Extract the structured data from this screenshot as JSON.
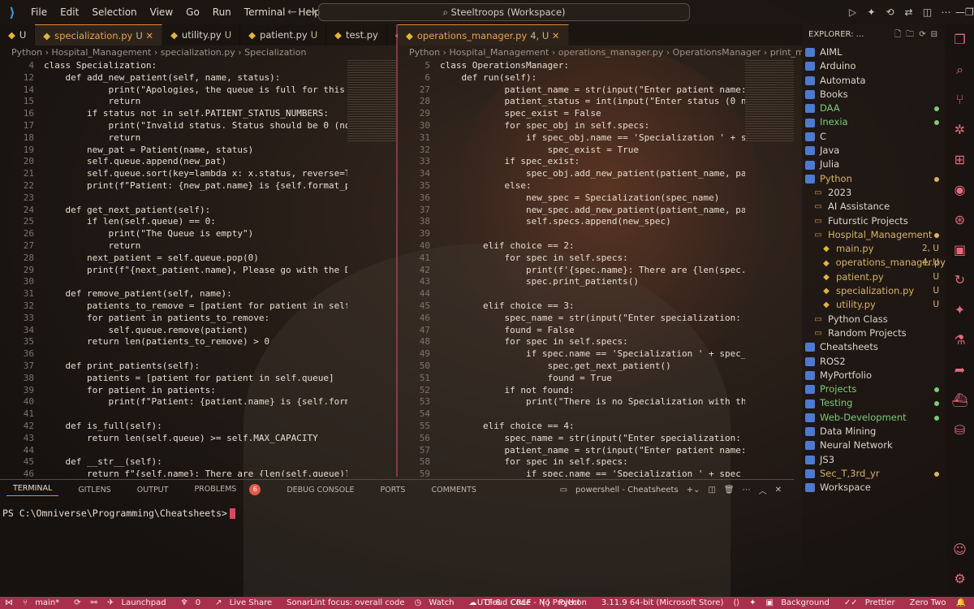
{
  "window": {
    "title": "Steeltroops (Workspace)",
    "menu": [
      "File",
      "Edit",
      "Selection",
      "View",
      "Go",
      "Run",
      "Terminal",
      "Help"
    ]
  },
  "tabs_left": [
    {
      "name": "U",
      "mod": ""
    },
    {
      "name": "specialization.py",
      "mod": "U",
      "active": true
    },
    {
      "name": "utility.py",
      "mod": "U"
    },
    {
      "name": "patient.py",
      "mod": "U"
    },
    {
      "name": "test.py",
      "mod": ""
    },
    {
      "name": "3",
      "mod": ""
    }
  ],
  "tabs_right": [
    {
      "name": "operations_manager.py",
      "mod": "4, U",
      "active": true
    }
  ],
  "breadcrumb_left": "Python › Hospital_Management › specialization.py › Specialization",
  "breadcrumb_right": "Python › Hospital_Management › operations_manager.py › OperationsManager › print_m",
  "editor_left": [
    {
      "n": "4",
      "c": "class Specialization:"
    },
    {
      "n": "12",
      "c": "    def add_new_patient(self, name, status):"
    },
    {
      "n": "14",
      "c": "            print(\"Apologies, the queue is full for this spec"
    },
    {
      "n": "15",
      "c": "            return"
    },
    {
      "n": "16",
      "c": "        if status not in self.PATIENT_STATUS_NUMBERS:"
    },
    {
      "n": "17",
      "c": "            print(\"Invalid status. Status should be 0 (normal"
    },
    {
      "n": "18",
      "c": "            return"
    },
    {
      "n": "19",
      "c": "        new_pat = Patient(name, status)"
    },
    {
      "n": "20",
      "c": "        self.queue.append(new_pat)"
    },
    {
      "n": "21",
      "c": "        self.queue.sort(key=lambda x: x.status, reverse=True)"
    },
    {
      "n": "22",
      "c": "        print(f\"Patient: {new_pat.name} is {self.format_patien"
    },
    {
      "n": "23",
      "c": ""
    },
    {
      "n": "24",
      "c": "    def get_next_patient(self):"
    },
    {
      "n": "25",
      "c": "        if len(self.queue) == 0:"
    },
    {
      "n": "26",
      "c": "            print(\"The Queue is empty\")"
    },
    {
      "n": "27",
      "c": "            return"
    },
    {
      "n": "28",
      "c": "        next_patient = self.queue.pop(0)"
    },
    {
      "n": "29",
      "c": "        print(f\"{next_patient.name}, Please go with the Dr\")"
    },
    {
      "n": "30",
      "c": ""
    },
    {
      "n": "31",
      "c": "    def remove_patient(self, name):"
    },
    {
      "n": "32",
      "c": "        patients_to_remove = [patient for patient in self.queu"
    },
    {
      "n": "33",
      "c": "        for patient in patients_to_remove:"
    },
    {
      "n": "34",
      "c": "            self.queue.remove(patient)"
    },
    {
      "n": "35",
      "c": "        return len(patients_to_remove) > 0"
    },
    {
      "n": "36",
      "c": ""
    },
    {
      "n": "37",
      "c": "    def print_patients(self):"
    },
    {
      "n": "38",
      "c": "        patients = [patient for patient in self.queue]"
    },
    {
      "n": "39",
      "c": "        for patient in patients:"
    },
    {
      "n": "40",
      "c": "            print(f\"Patient: {patient.name} is {self.format_pa"
    },
    {
      "n": "41",
      "c": ""
    },
    {
      "n": "42",
      "c": "    def is_full(self):"
    },
    {
      "n": "43",
      "c": "        return len(self.queue) >= self.MAX_CAPACITY"
    },
    {
      "n": "44",
      "c": ""
    },
    {
      "n": "45",
      "c": "    def __str__(self):"
    },
    {
      "n": "46",
      "c": "        return f\"{self.name}: There are {len(self.queue)} pat"
    }
  ],
  "editor_right": [
    {
      "n": "5",
      "c": "class OperationsManager:"
    },
    {
      "n": "6",
      "c": "    def run(self):"
    },
    {
      "n": "27",
      "c": "            patient_name = str(input(\"Enter patient name: "
    },
    {
      "n": "28",
      "c": "            patient_status = int(input(\"Enter status (0 no"
    },
    {
      "n": "29",
      "c": "            spec_exist = False"
    },
    {
      "n": "30",
      "c": "            for spec_obj in self.specs:"
    },
    {
      "n": "31",
      "c": "                if spec_obj.name == 'Specialization ' + sp"
    },
    {
      "n": "32",
      "c": "                    spec_exist = True"
    },
    {
      "n": "33",
      "c": "            if spec_exist:"
    },
    {
      "n": "34",
      "c": "                spec_obj.add_new_patient(patient_name, pat"
    },
    {
      "n": "35",
      "c": "            else:"
    },
    {
      "n": "36",
      "c": "                new_spec = Specialization(spec_name)"
    },
    {
      "n": "37",
      "c": "                new_spec.add_new_patient(patient_name, pat"
    },
    {
      "n": "38",
      "c": "                self.specs.append(new_spec)"
    },
    {
      "n": "39",
      "c": ""
    },
    {
      "n": "40",
      "c": "        elif choice == 2:"
    },
    {
      "n": "41",
      "c": "            for spec in self.specs:"
    },
    {
      "n": "42",
      "c": "                print(f'{spec.name}: There are {len(spec.q"
    },
    {
      "n": "43",
      "c": "                spec.print_patients()"
    },
    {
      "n": "44",
      "c": ""
    },
    {
      "n": "45",
      "c": "        elif choice == 3:"
    },
    {
      "n": "46",
      "c": "            spec_name = str(input(\"Enter specialization: '"
    },
    {
      "n": "47",
      "c": "            found = False"
    },
    {
      "n": "48",
      "c": "            for spec in self.specs:"
    },
    {
      "n": "49",
      "c": "                if spec.name == 'Specialization ' + spec_n"
    },
    {
      "n": "50",
      "c": "                    spec.get_next_patient()"
    },
    {
      "n": "51",
      "c": "                    found = True"
    },
    {
      "n": "52",
      "c": "            if not found:"
    },
    {
      "n": "53",
      "c": "                print(\"There is no Specialization with th"
    },
    {
      "n": "54",
      "c": ""
    },
    {
      "n": "55",
      "c": "        elif choice == 4:"
    },
    {
      "n": "56",
      "c": "            spec_name = str(input(\"Enter specialization: '"
    },
    {
      "n": "57",
      "c": "            patient_name = str(input(\"Enter patient name: "
    },
    {
      "n": "58",
      "c": "            for spec in self.specs:"
    },
    {
      "n": "59",
      "c": "                if spec.name == 'Specialization ' + spec_n"
    }
  ],
  "explorer": {
    "title": "EXPLORER: ...",
    "items": [
      {
        "label": "AIML",
        "type": "ws",
        "indent": 0
      },
      {
        "label": "Arduino",
        "type": "ws",
        "indent": 0
      },
      {
        "label": "Automata",
        "type": "ws",
        "indent": 0
      },
      {
        "label": "Books",
        "type": "ws",
        "indent": 0
      },
      {
        "label": "DAA",
        "type": "ws",
        "indent": 0,
        "color": "green",
        "dot": true
      },
      {
        "label": "Inexia",
        "type": "ws",
        "indent": 0,
        "color": "green",
        "dot": true
      },
      {
        "label": "C",
        "type": "ws",
        "indent": 0
      },
      {
        "label": "Java",
        "type": "ws",
        "indent": 0
      },
      {
        "label": "Julia",
        "type": "ws",
        "indent": 0
      },
      {
        "label": "Python",
        "type": "ws",
        "indent": 0,
        "color": "yellow",
        "dot": true
      },
      {
        "label": "2023",
        "type": "folder",
        "indent": 1
      },
      {
        "label": "AI Assistance",
        "type": "folder",
        "indent": 1
      },
      {
        "label": "Futurstic Projects",
        "type": "folder",
        "indent": 1
      },
      {
        "label": "Hospital_Management",
        "type": "folder",
        "indent": 1,
        "color": "yellow",
        "dot": true
      },
      {
        "label": "main.py",
        "type": "py",
        "indent": 2,
        "color": "yellow",
        "badge": "2, U"
      },
      {
        "label": "operations_manager.py",
        "type": "py",
        "indent": 2,
        "color": "yellow",
        "badge": "4, U"
      },
      {
        "label": "patient.py",
        "type": "py",
        "indent": 2,
        "color": "yellow",
        "badge": "U"
      },
      {
        "label": "specialization.py",
        "type": "py",
        "indent": 2,
        "color": "yellow",
        "badge": "U"
      },
      {
        "label": "utility.py",
        "type": "py",
        "indent": 2,
        "color": "yellow",
        "badge": "U"
      },
      {
        "label": "Python Class",
        "type": "folder",
        "indent": 1
      },
      {
        "label": "Random Projects",
        "type": "folder",
        "indent": 1
      },
      {
        "label": "Cheatsheets",
        "type": "ws",
        "indent": 0
      },
      {
        "label": "ROS2",
        "type": "ws",
        "indent": 0
      },
      {
        "label": "MyPortfolio",
        "type": "ws",
        "indent": 0
      },
      {
        "label": "Projects",
        "type": "ws",
        "indent": 0,
        "color": "green",
        "dot": true
      },
      {
        "label": "Testing",
        "type": "ws",
        "indent": 0,
        "color": "green",
        "dot": true
      },
      {
        "label": "Web-Development",
        "type": "ws",
        "indent": 0,
        "color": "green",
        "dot": true
      },
      {
        "label": "Data Mining",
        "type": "ws",
        "indent": 0
      },
      {
        "label": "Neural Network",
        "type": "ws",
        "indent": 0
      },
      {
        "label": "JS3",
        "type": "ws",
        "indent": 0
      },
      {
        "label": "Sec_T,3rd_yr",
        "type": "ws",
        "indent": 0,
        "color": "yellow",
        "dot": true
      },
      {
        "label": "Workspace",
        "type": "ws",
        "indent": 0
      }
    ]
  },
  "panel": {
    "tabs": [
      "TERMINAL",
      "GITLENS",
      "OUTPUT",
      "PROBLEMS",
      "DEBUG CONSOLE",
      "PORTS",
      "COMMENTS"
    ],
    "problems_count": "6",
    "terminal_name": "powershell - Cheatsheets",
    "prompt": "PS C:\\Omniverse\\Programming\\Cheatsheets>"
  },
  "statusbar": {
    "left": [
      "main*",
      "0",
      "Launchpad",
      "0",
      "Live Share",
      "SonarLint focus: overall code",
      "Watch",
      "Cloud Code - No Project"
    ],
    "right": [
      "UTF-8",
      "CRLF",
      "Python",
      "3.11.9 64-bit (Microsoft Store)",
      "Background",
      "Prettier",
      "Zero Two"
    ]
  },
  "colors": {
    "accent": "#e38b3b",
    "status_bar": "#a8304c",
    "split": "#b04060"
  }
}
